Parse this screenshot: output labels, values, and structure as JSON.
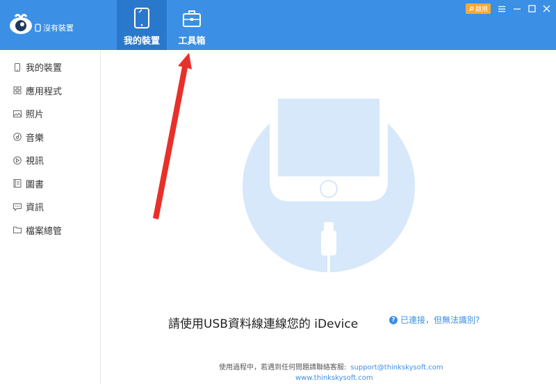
{
  "header": {
    "device_status": "沒有裝置",
    "tabs": [
      {
        "label": "我的裝置",
        "icon": "phone-icon",
        "active": true
      },
      {
        "label": "工具箱",
        "icon": "toolbox-icon",
        "active": false
      }
    ],
    "activate_label": "啟用"
  },
  "sidebar": {
    "items": [
      {
        "label": "我的裝置",
        "icon": "device-icon"
      },
      {
        "label": "應用程式",
        "icon": "apps-icon"
      },
      {
        "label": "照片",
        "icon": "photo-icon"
      },
      {
        "label": "音樂",
        "icon": "music-icon"
      },
      {
        "label": "視訊",
        "icon": "video-icon"
      },
      {
        "label": "圖書",
        "icon": "book-icon"
      },
      {
        "label": "資訊",
        "icon": "message-icon"
      },
      {
        "label": "檔案總管",
        "icon": "folder-icon"
      }
    ]
  },
  "main": {
    "prompt": "請使用USB資料線連線您的 iDevice",
    "help_link": "已連接，但無法識別?",
    "footer_text": "使用過程中，若遇到任何問題請聯絡客服:",
    "support_email": "support@thinkskysoft.com",
    "website": "www.thinkskysoft.com"
  },
  "colors": {
    "brand_blue": "#3b8fe5",
    "active_tab": "#2a78cc",
    "illustration_bg": "#d6e8fa",
    "arrow_red": "#e8302a",
    "activate_badge": "#f6a93b"
  }
}
